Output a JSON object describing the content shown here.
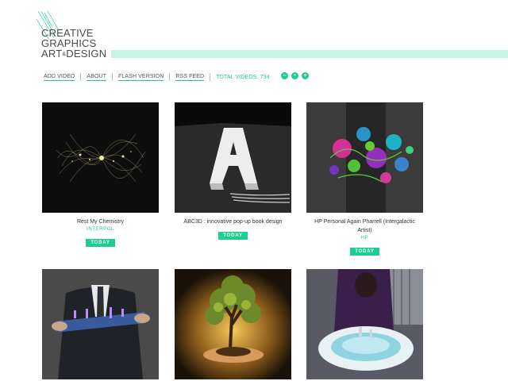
{
  "logo": {
    "line1": "CREATIVE",
    "line2": "GRAPHICS",
    "line3a": "ART",
    "line3amp": "&",
    "line3b": "DESIGN"
  },
  "nav": {
    "items": [
      "ADD VIDEO",
      "ABOUT",
      "FLASH VERSION",
      "RSS FEED"
    ],
    "total_label": "TOTAL VIDEOS: 734",
    "dots": [
      "–",
      "•",
      "+"
    ]
  },
  "colors": {
    "accent": "#1ccf8f"
  },
  "videos": [
    {
      "title": "Rest My Chemistry",
      "source": "INTERPOL",
      "badge": "TODAY",
      "thumb": "particle-burst"
    },
    {
      "title": "ABC3D : innovative pop-up book design",
      "source": "",
      "badge": "TODAY",
      "thumb": "letter-a"
    },
    {
      "title": "HP Personal Again Pharrell (Intergalactic Artist)",
      "source": "HP",
      "badge": "TODAY",
      "thumb": "paint-splash"
    },
    {
      "title": "",
      "source": "",
      "badge": "",
      "thumb": "hologram-hands"
    },
    {
      "title": "",
      "source": "",
      "badge": "",
      "thumb": "glowing-tree"
    },
    {
      "title": "",
      "source": "",
      "badge": "",
      "thumb": "snow-landscape"
    }
  ]
}
